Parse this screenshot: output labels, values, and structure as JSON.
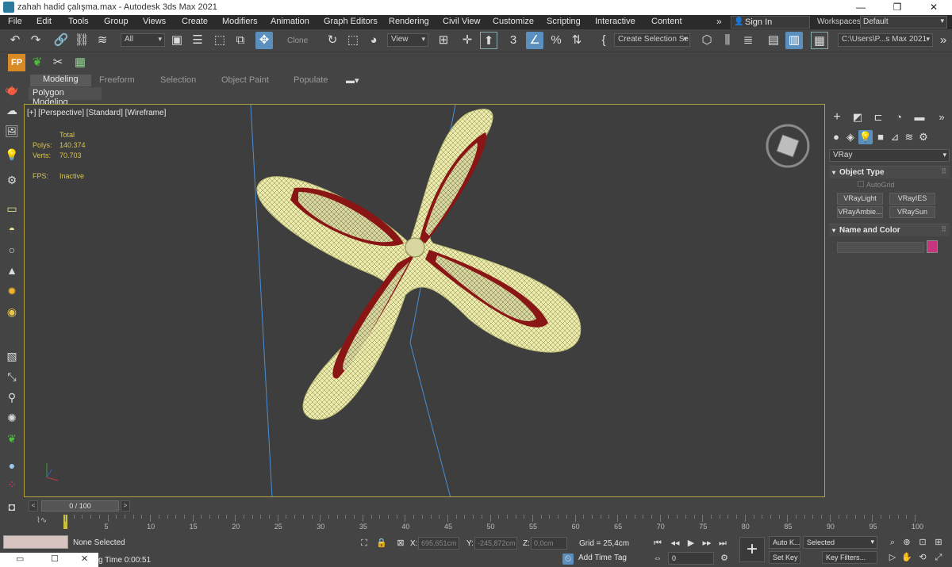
{
  "window": {
    "title": "zahah hadid çalışma.max - Autodesk 3ds Max 2021",
    "minimize": "—",
    "maximize": "❐",
    "close": "✕"
  },
  "menubar": {
    "items": [
      "File",
      "Edit",
      "Tools",
      "Group",
      "Views",
      "Create",
      "Modifiers",
      "Animation",
      "Graph Editors",
      "Rendering",
      "Civil View",
      "Customize",
      "Scripting",
      "Interactive",
      "Content"
    ],
    "more": "»",
    "sign_in": "Sign In",
    "workspaces_label": "Workspaces:",
    "workspace_value": "Default"
  },
  "toolbar": {
    "selection_filter": "All",
    "clone_label": "Clone",
    "ref_coord": "View",
    "named_selection_placeholder": "Create Selection Se",
    "project_path": "C:\\Users\\P...s Max 2021"
  },
  "ribbon": {
    "tabs": [
      "Modeling",
      "Freeform",
      "Selection",
      "Object Paint",
      "Populate"
    ],
    "active_tab": "Modeling",
    "panel_label": "Polygon Modeling"
  },
  "viewport": {
    "label": "[+] [Perspective] [Standard] [Wireframe]",
    "stats": {
      "total_label": "Total",
      "polys_label": "Polys:",
      "polys_value": "140.374",
      "verts_label": "Verts:",
      "verts_value": "70.703",
      "fps_label": "FPS:",
      "fps_value": "Inactive"
    },
    "colors": {
      "background": "#3e3e3e",
      "border_active": "#b1a13d",
      "shape_fill": "#ecebaa",
      "inner_fill": "#8a1515",
      "wire": "#6a6a40"
    }
  },
  "command_panel": {
    "renderer": "VRay",
    "object_type_header": "Object Type",
    "autogrid": "AutoGrid",
    "buttons": [
      "VRayLight",
      "VRayIES",
      "VRayAmbie...",
      "VRaySun"
    ],
    "name_color_header": "Name and Color",
    "object_color": "#c8347e"
  },
  "timeline": {
    "frame_display": "0 / 100",
    "ticks": [
      "0",
      "5",
      "10",
      "15",
      "20",
      "25",
      "30",
      "35",
      "40",
      "45",
      "50",
      "55",
      "60",
      "65",
      "70",
      "75",
      "80",
      "85",
      "90",
      "95",
      "100"
    ]
  },
  "statusbar": {
    "selection": "None Selected",
    "render_time": "g Time  0:00:51",
    "x_label": "X:",
    "x_value": "695,651cm",
    "y_label": "Y:",
    "y_value": "-245,872cm",
    "z_label": "Z:",
    "z_value": "0,0cm",
    "grid": "Grid = 25,4cm",
    "add_time_tag": "Add Time Tag",
    "auto_key": "Auto K...",
    "set_key": "Set Key",
    "key_mode": "Selected",
    "key_filters": "Key Filters...",
    "frame_field": "0"
  },
  "taskbar": {
    "glyphs": [
      "▭",
      "☐",
      "✕"
    ]
  }
}
